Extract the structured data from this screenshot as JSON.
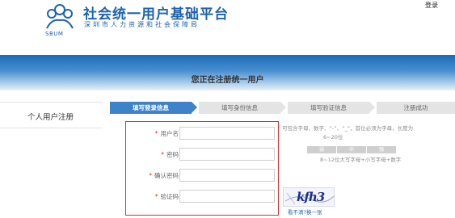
{
  "header": {
    "logo_abbr": "SBUM",
    "title": "社会统一用户基础平台",
    "subtitle": "深圳市人力资源和社会保障局",
    "login_link": "登录"
  },
  "page": {
    "title": "您正在注册统一用户"
  },
  "sidebar": {
    "items": [
      {
        "label": "个人用户注册"
      }
    ]
  },
  "steps": [
    {
      "label": "填写登录信息",
      "active": true
    },
    {
      "label": "填写身份信息",
      "active": false
    },
    {
      "label": "填写验证信息",
      "active": false
    },
    {
      "label": "注册成功",
      "active": false
    }
  ],
  "form": {
    "required_mark": "*",
    "fields": [
      {
        "label": "用户名",
        "value": ""
      },
      {
        "label": "密码",
        "value": ""
      },
      {
        "label": "确认密码",
        "value": ""
      },
      {
        "label": "验证码",
        "value": ""
      }
    ]
  },
  "hints": {
    "username": "可包含字母、数字、“-”、“_”，首位必须为字母，长度为",
    "username_length": "6~20位",
    "password_strength": [
      "弱",
      "中",
      "强"
    ],
    "password_rule": "8~12位大写字母+小写字母+数字",
    "captcha_text": "kfh3",
    "captcha_refresh": "看不清?换一张"
  },
  "colors": {
    "brand": "#1e63ae",
    "active_step": "#3e83c8",
    "error_border": "#d8312d"
  }
}
